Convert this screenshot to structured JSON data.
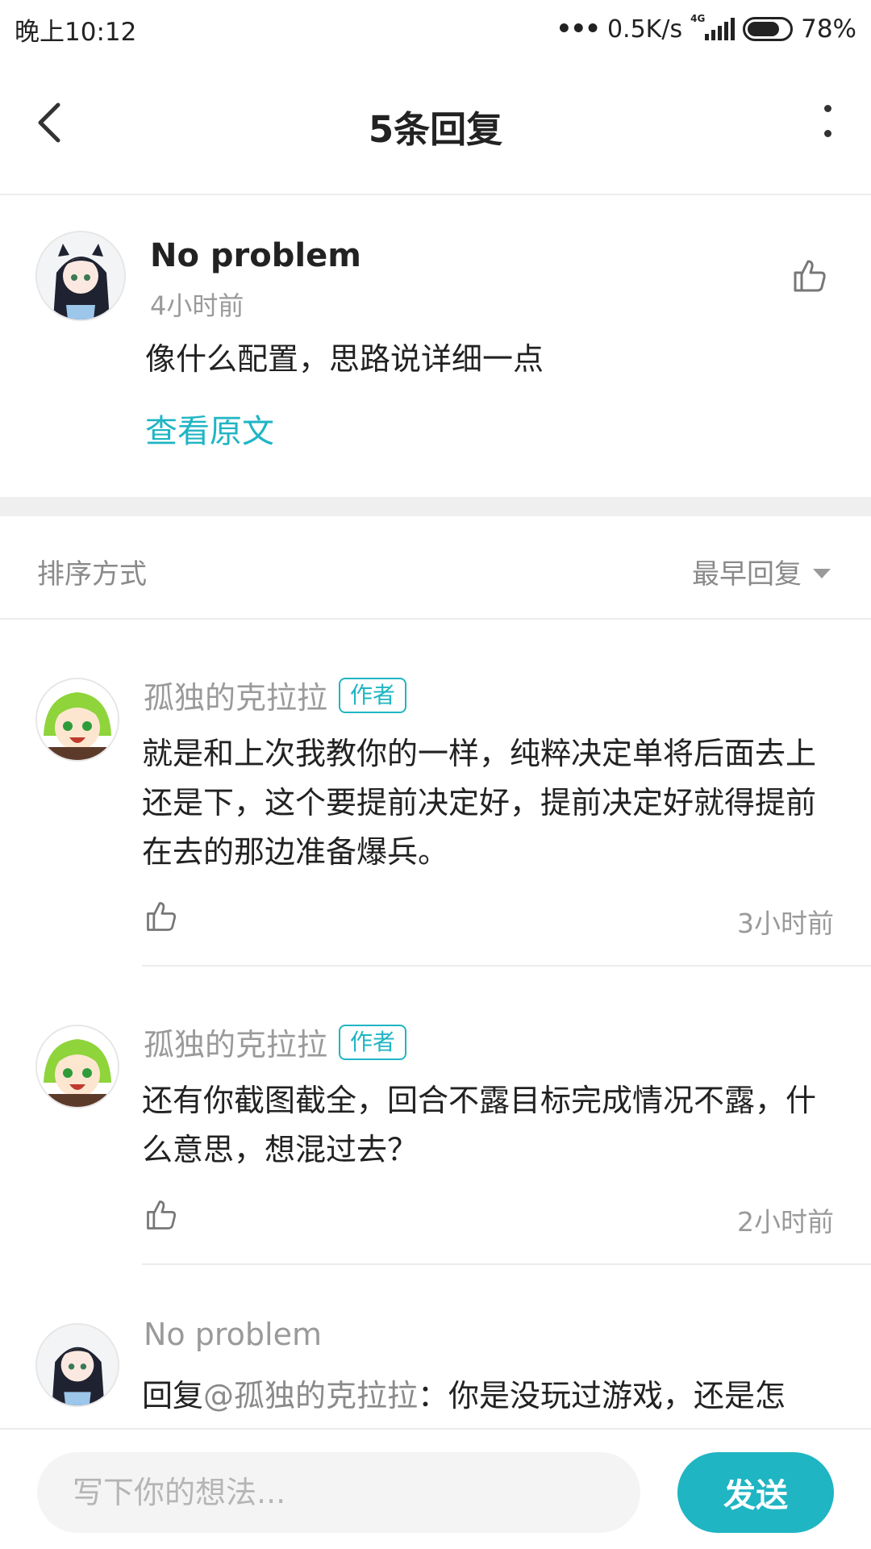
{
  "status_bar": {
    "time": "晚上10:12",
    "network_speed": "0.5K/s",
    "network_type": "4G",
    "battery": "78%",
    "battery_level": 0.78
  },
  "header": {
    "title": "5条回复"
  },
  "main_comment": {
    "author": "No problem",
    "time": "4小时前",
    "text": "像什么配置，思路说详细一点",
    "view_original": "查看原文"
  },
  "sort": {
    "label": "排序方式",
    "selected": "最早回复"
  },
  "replies": [
    {
      "author": "孤独的克拉拉",
      "badge": "作者",
      "text": "就是和上次我教你的一样，纯粹决定单将后面去上还是下，这个要提前决定好，提前决定好就得提前在去的那边准备爆兵。",
      "time": "3小时前"
    },
    {
      "author": "孤独的克拉拉",
      "badge": "作者",
      "text": "还有你截图截全，回合不露目标完成情况不露，什么意思，想混过去？",
      "time": "2小时前"
    },
    {
      "author": "No problem",
      "reply_prefix": "回复",
      "mention": "@孤独的克拉拉",
      "text": "：你是没玩过游戏，还是怎"
    }
  ],
  "input": {
    "placeholder": "写下你的想法...",
    "send_label": "发送"
  },
  "colors": {
    "accent": "#1fb5c3",
    "muted": "#9a9a9a",
    "divider": "#ececec"
  }
}
